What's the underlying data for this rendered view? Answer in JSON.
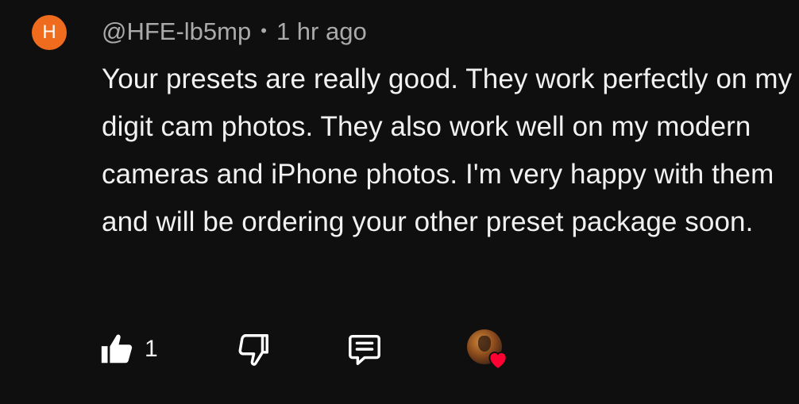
{
  "comment": {
    "avatar_letter": "H",
    "avatar_color": "#ef6c1e",
    "author": "@HFE-lb5mp",
    "separator": "•",
    "time": "1 hr ago",
    "text": "Your presets are really good. They work perfectly on my digit cam photos. They also work well on my modern cameras and iPhone photos. I'm very happy with them and will be ordering your other preset package soon."
  },
  "actions": {
    "like_icon": "thumbs-up-icon",
    "like_count": "1",
    "dislike_icon": "thumbs-down-icon",
    "reply_icon": "comment-reply-icon",
    "creator_heart_icon": "creator-heart-icon",
    "heart_color": "#ff0033"
  }
}
